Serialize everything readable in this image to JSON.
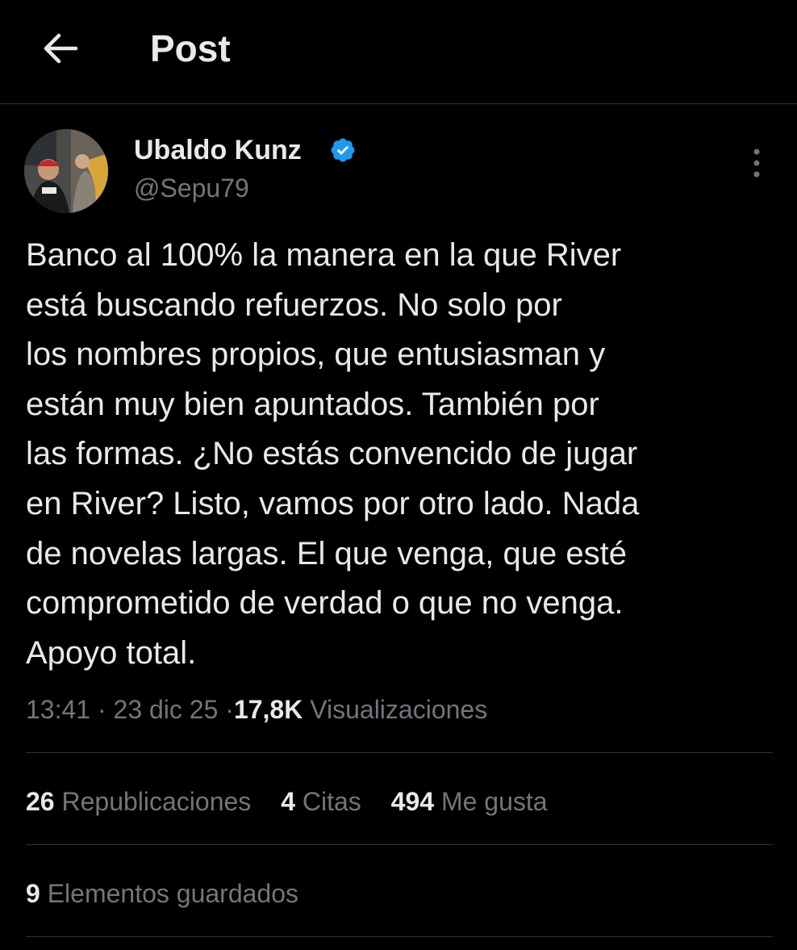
{
  "header": {
    "back_icon": "arrow-left-icon",
    "title": "Post"
  },
  "author": {
    "name": "Ubaldo Kunz",
    "handle": "@Sepu79",
    "verified_icon": "verified-badge-icon",
    "verified_color": "#1d9bf0"
  },
  "more_icon": "more-vertical-icon",
  "tweet": {
    "lines": [
      "Banco al 100% la manera en la que River",
      "está buscando refuerzos. No solo por",
      "los nombres propios, que entusiasman y",
      "están muy bien apuntados. También por",
      "las formas. ¿No estás convencido de jugar",
      "en River? Listo, vamos por otro lado. Nada",
      "de novelas largas. El que venga, que esté",
      "comprometido de verdad o que no venga.",
      "Apoyo total."
    ]
  },
  "meta": {
    "time": "13:41",
    "separator": "·",
    "date": "23 dic 25",
    "views_count": "17,8K",
    "views_label": "Visualizaciones"
  },
  "stats": {
    "reposts_count": "26",
    "reposts_label": "Republicaciones",
    "quotes_count": "4",
    "quotes_label": "Citas",
    "likes_count": "494",
    "likes_label": "Me gusta"
  },
  "bookmarks": {
    "count": "9",
    "label": "Elementos guardados"
  },
  "colors": {
    "background": "#000000",
    "text_primary": "#e7e9ea",
    "text_secondary": "#71767b",
    "divider": "#2f3336"
  }
}
